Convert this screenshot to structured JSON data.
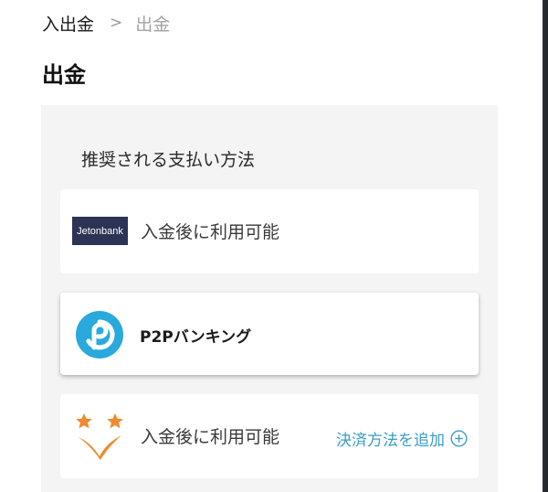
{
  "breadcrumb": {
    "parent": "入出金",
    "separator": ">",
    "current": "出金"
  },
  "page": {
    "title": "出金"
  },
  "panel": {
    "title": "推奨される支払い方法"
  },
  "methods": [
    {
      "logo_text": "Jetonbank",
      "logo_icon": "jetonbank-logo",
      "status": "入金後に利用可能"
    },
    {
      "logo_icon": "p2p-banking-logo",
      "name": "P2Pバンキング"
    },
    {
      "logo_icon": "stars-checkmark-logo",
      "status": "入金後に利用可能",
      "action_label": "決済方法を追加",
      "action_icon": "plus-circle-icon"
    }
  ],
  "colors": {
    "accent": "#3b9dc7",
    "panel_bg": "#f4f4f4",
    "jeton_bg": "#2d3354",
    "p2p_blue": "#29a9dc",
    "star_orange": "#ef8a30"
  }
}
